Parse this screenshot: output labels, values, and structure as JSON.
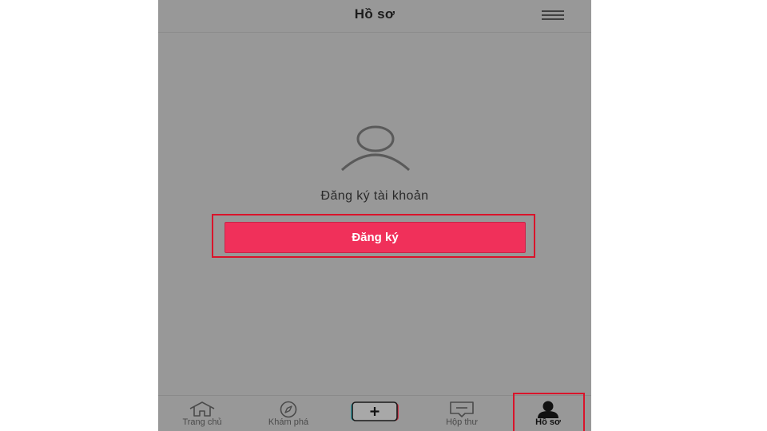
{
  "header": {
    "title": "Hồ sơ",
    "menu_icon": "hamburger-menu-icon"
  },
  "main": {
    "avatar_icon": "user-placeholder-icon",
    "prompt": "Đăng ký tài khoản",
    "register_button": "Đăng ký"
  },
  "bottom_nav": {
    "items": [
      {
        "label": "Trang chủ",
        "icon": "home-icon"
      },
      {
        "label": "Khám phá",
        "icon": "compass-icon"
      },
      {
        "label": "",
        "icon": "plus-icon"
      },
      {
        "label": "Hộp thư",
        "icon": "inbox-icon"
      },
      {
        "label": "Hồ sơ",
        "icon": "profile-icon",
        "active": true
      }
    ]
  },
  "colors": {
    "overlay_background": "#989898",
    "register_button": "#f0305a",
    "highlight_border": "#d9142b"
  }
}
